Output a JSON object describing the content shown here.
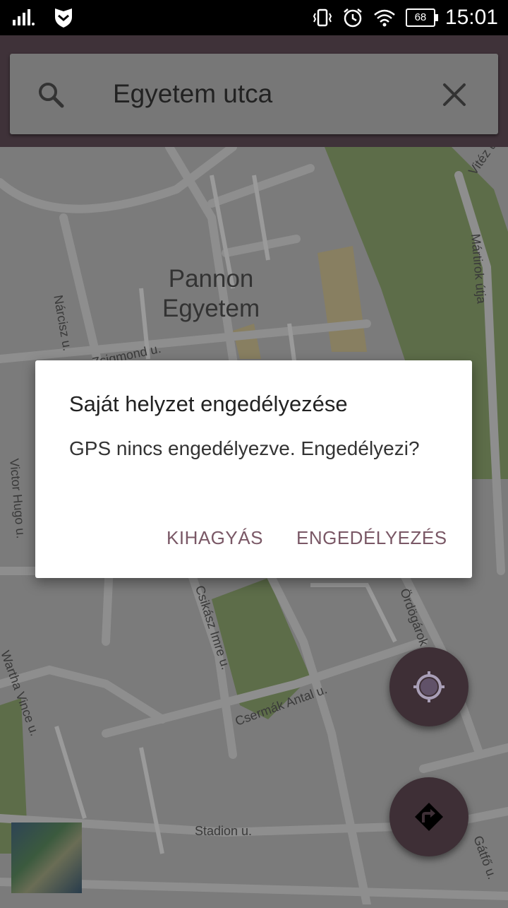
{
  "status_bar": {
    "time": "15:01",
    "battery": "68",
    "icons": [
      "signal-icon",
      "shield-icon",
      "vibrate-icon",
      "alarm-icon",
      "wifi-icon",
      "battery-icon"
    ]
  },
  "search": {
    "query": "Egyetem utca",
    "icons": [
      "search-icon",
      "close-icon"
    ]
  },
  "map": {
    "poi": "Pannon\nEgyetem",
    "streets": [
      {
        "name": "Nárcisz u."
      },
      {
        "name": "Zsigmond u."
      },
      {
        "name": "Mártirok útja"
      },
      {
        "name": "Vitéz u."
      },
      {
        "name": "Victor Hugo u."
      },
      {
        "name": "Csikász Imre u."
      },
      {
        "name": "Ördögárok"
      },
      {
        "name": "Wartha Vince u."
      },
      {
        "name": "Csermák Antal u."
      },
      {
        "name": "Stadion u."
      },
      {
        "name": "Gátfő u."
      }
    ]
  },
  "dialog": {
    "title": "Saját helyzet engedélyezése",
    "message": "GPS nincs engedélyezve. Engedélyezi?",
    "skip_label": "KIHAGYÁS",
    "allow_label": "ENGEDÉLYEZÉS"
  },
  "colors": {
    "toolbar": "#3f3239",
    "fab": "#3e2f36",
    "accent": "#7a5866",
    "park": "#5d6d49"
  }
}
